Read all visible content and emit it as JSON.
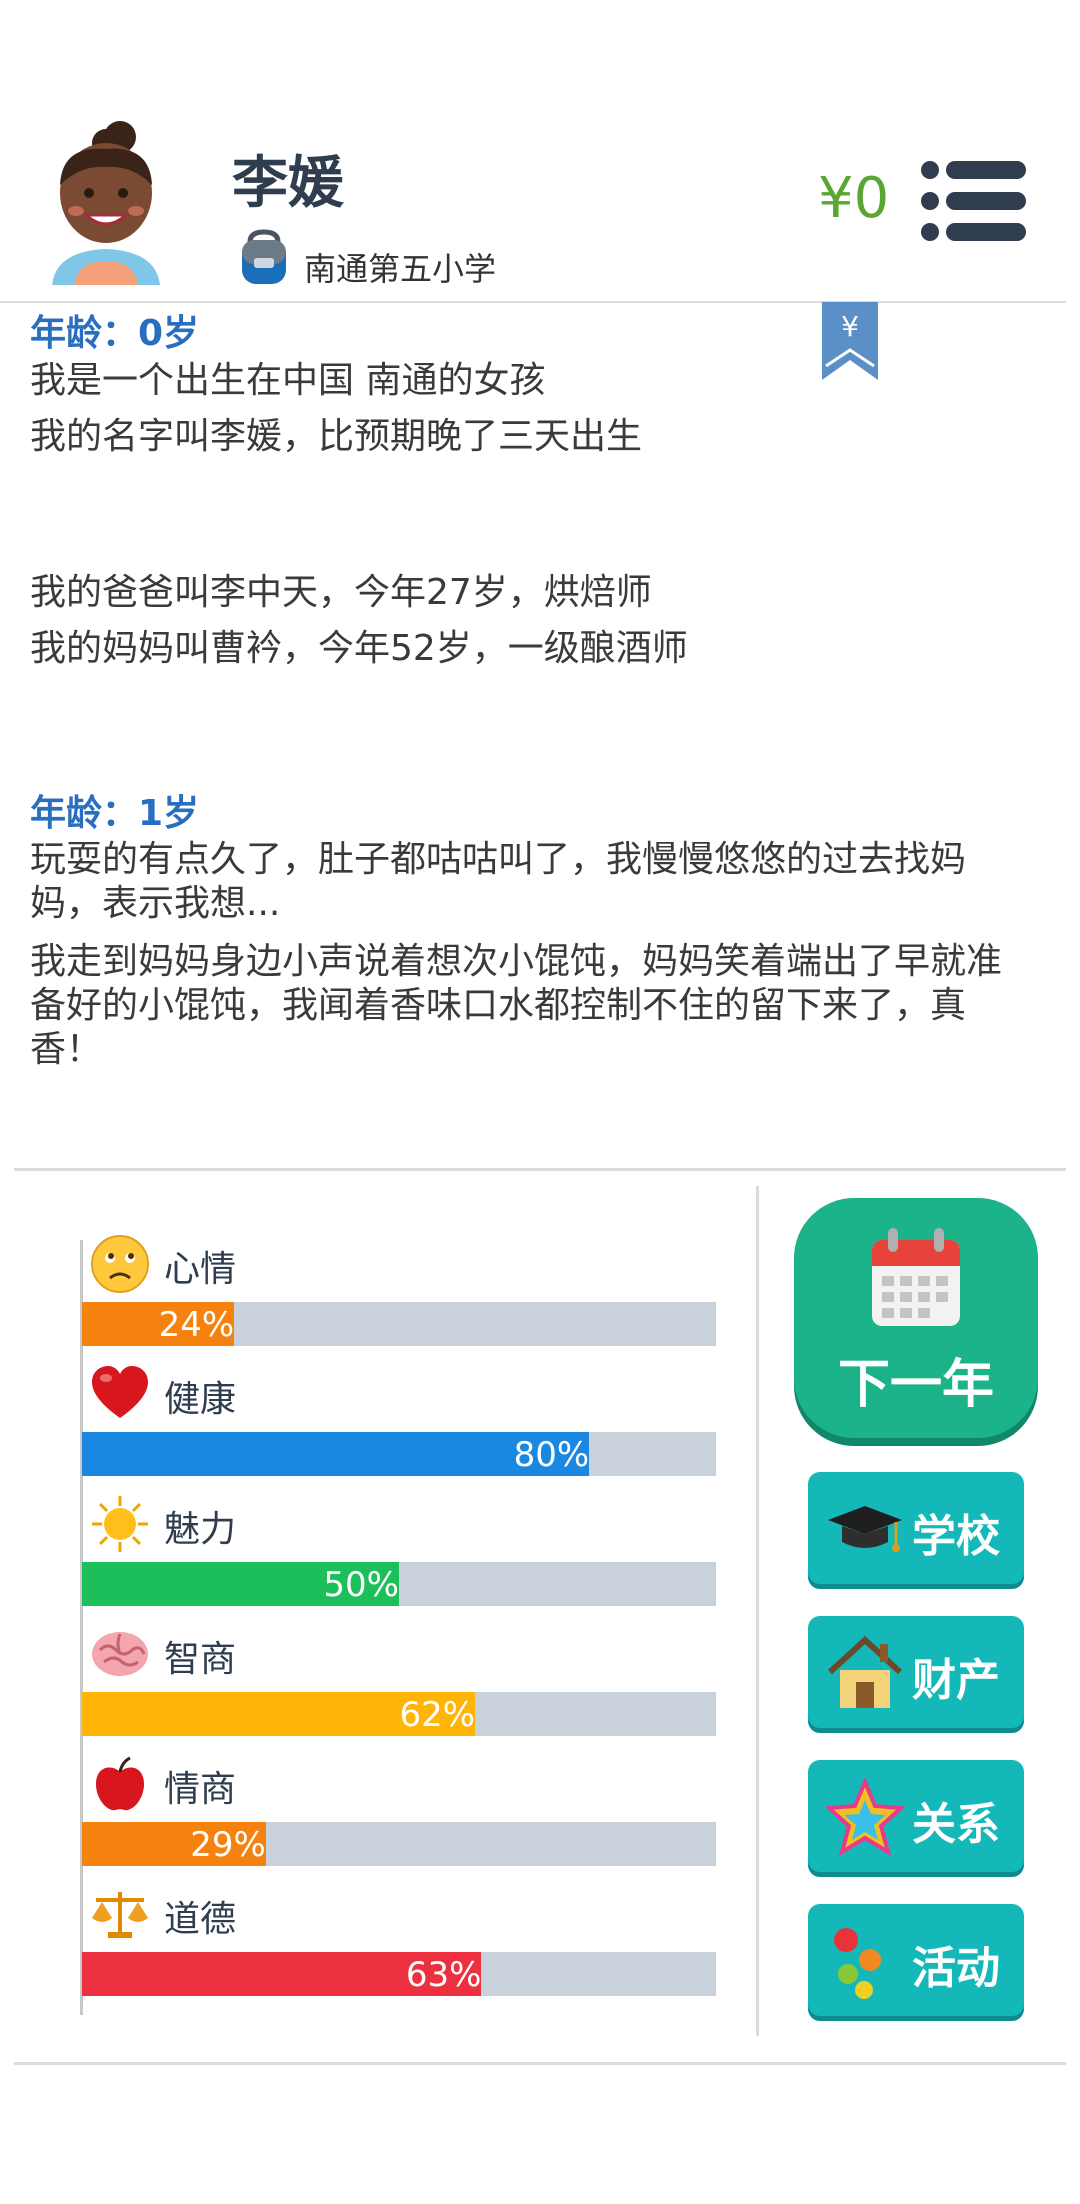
{
  "profile": {
    "name": "李媛",
    "school": "南通第五小学",
    "money": "¥0"
  },
  "bookmark_label": "¥",
  "story": [
    {
      "age": "年龄：0岁",
      "lines": [
        "我是一个出生在中国 南通的女孩",
        "我的名字叫李媛，比预期晚了三天出生"
      ]
    },
    {
      "lines": [
        "我的爸爸叫李中天，今年27岁，烘焙师",
        "我的妈妈叫曹衿，今年52岁，一级酿酒师"
      ]
    },
    {
      "age": "年龄：1岁",
      "lines": [
        "玩耍的有点久了，肚子都咕咕叫了，我慢慢悠悠的过去找妈妈，表示我想...",
        "我走到妈妈身边小声说着想次小馄饨，妈妈笑着端出了早就准备好的小馄饨，我闻着香味口水都控制不住的留下来了，真香！"
      ]
    }
  ],
  "stats": [
    {
      "label": "心情",
      "value": 24,
      "text": "24%",
      "color": "#f5820f",
      "icon": "sad-face-icon"
    },
    {
      "label": "健康",
      "value": 80,
      "text": "80%",
      "color": "#1a88e0",
      "icon": "heart-icon"
    },
    {
      "label": "魅力",
      "value": 50,
      "text": "50%",
      "color": "#1dbf5a",
      "icon": "sun-icon"
    },
    {
      "label": "智商",
      "value": 62,
      "text": "62%",
      "color": "#ffb508",
      "icon": "brain-icon"
    },
    {
      "label": "情商",
      "value": 29,
      "text": "29%",
      "color": "#f5820f",
      "icon": "apple-icon"
    },
    {
      "label": "道德",
      "value": 63,
      "text": "63%",
      "color": "#ec3040",
      "icon": "scales-icon"
    }
  ],
  "actions": {
    "next_year": "下一年",
    "school": "学校",
    "property": "财产",
    "relations": "关系",
    "activities": "活动"
  }
}
